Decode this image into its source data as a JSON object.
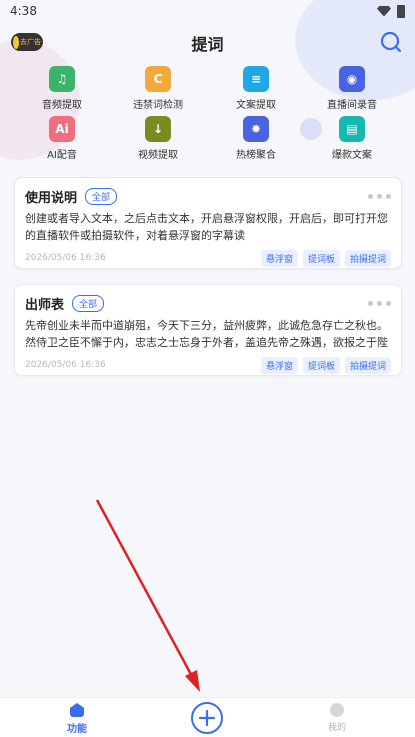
{
  "status_bar": {
    "time": "4:38"
  },
  "header": {
    "title": "提词",
    "ad_badge": "去广告"
  },
  "functions": [
    {
      "label": "音频提取",
      "icon": "audio-extract-icon",
      "color": "#3bb36b",
      "glyph": "♫"
    },
    {
      "label": "违禁词检测",
      "icon": "banned-words-icon",
      "color": "#f2a93b",
      "glyph": "C"
    },
    {
      "label": "文案提取",
      "icon": "copy-extract-icon",
      "color": "#1fa7e8",
      "glyph": "≡"
    },
    {
      "label": "直播间录音",
      "icon": "live-record-icon",
      "color": "#4a63e0",
      "glyph": "◉"
    },
    {
      "label": "AI配音",
      "icon": "ai-dub-icon",
      "color": "#ef6d7f",
      "glyph": "Ai"
    },
    {
      "label": "视频提取",
      "icon": "video-extract-icon",
      "color": "#7a8c1e",
      "glyph": "↓"
    },
    {
      "label": "热榜聚合",
      "icon": "hot-list-icon",
      "color": "#4a63e0",
      "glyph": "✹"
    },
    {
      "label": "爆款文案",
      "icon": "hot-copy-icon",
      "color": "#17b8b0",
      "glyph": "▤"
    }
  ],
  "cards": [
    {
      "title": "使用说明",
      "tag": "全部",
      "body": "创建或者导入文本，之后点击文本，开启悬浮窗权限，开启后，即可打开您的直播软件或拍摄软件，对着悬浮窗的字幕读",
      "time": "2026/05/06 16:36",
      "actions": [
        "悬浮窗",
        "提词板",
        "拍摄提词"
      ]
    },
    {
      "title": "出师表",
      "tag": "全部",
      "body": "先帝创业未半而中道崩殂，今天下三分，益州疲弊，此诚危急存亡之秋也。然侍卫之臣不懈于内，忠志之士忘身于外者，盖追先帝之殊遇，欲报之于陛下…",
      "time": "2026/05/06 16:36",
      "actions": [
        "悬浮窗",
        "提词板",
        "拍摄提词"
      ]
    }
  ],
  "bottom_nav": {
    "func_label": "功能",
    "me_label": "我的"
  },
  "colors": {
    "accent": "#3a6df0",
    "arrow": "#e02020"
  }
}
